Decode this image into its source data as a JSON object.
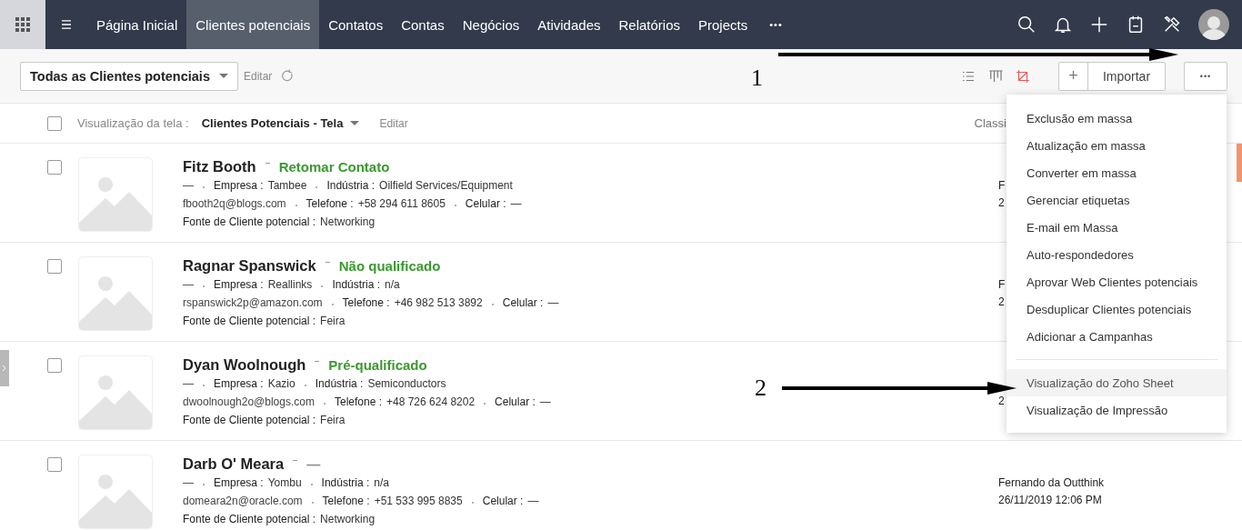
{
  "nav": {
    "tabs": [
      {
        "label": "Página Inicial",
        "selected": false
      },
      {
        "label": "Clientes potenciais",
        "selected": true
      },
      {
        "label": "Contatos",
        "selected": false
      },
      {
        "label": "Contas",
        "selected": false
      },
      {
        "label": "Negócios",
        "selected": false
      },
      {
        "label": "Atividades",
        "selected": false
      },
      {
        "label": "Relatórios",
        "selected": false
      },
      {
        "label": "Projects",
        "selected": false
      }
    ],
    "more": "•••"
  },
  "toolbar": {
    "view_select": "Todas as Clientes potenciais",
    "edit_link": "Editar",
    "add": "+",
    "import": "Importar",
    "more": "•••"
  },
  "subheader": {
    "checked": false,
    "view_label": "Visualização da tela :",
    "view_name": "Clientes Potenciais - Tela",
    "edit_link": "Editar",
    "sort_label": "Classi"
  },
  "rows": [
    {
      "checked": false,
      "name": "Fitz Booth",
      "status": {
        "text": "Retomar Contato",
        "color": "#3a9a2e"
      },
      "lines": [
        [
          {
            "value": "—"
          },
          {
            "label": "Empresa :",
            "value": "Tambee"
          },
          {
            "label": "Indústria :",
            "value": "Oilfield Services/Equipment"
          }
        ],
        [
          {
            "value": "fbooth2q@blogs.com"
          },
          {
            "label": "Telefone :",
            "value": "+58 294 611 8605"
          },
          {
            "label": "Celular :",
            "value": "—"
          }
        ],
        [
          {
            "label": "Fonte de Cliente potencial :",
            "value": "Networking"
          }
        ]
      ],
      "owner": "F",
      "date": "2"
    },
    {
      "checked": false,
      "name": "Ragnar Spanswick",
      "status": {
        "text": "Não qualificado",
        "color": "#3a9a2e"
      },
      "lines": [
        [
          {
            "value": "—"
          },
          {
            "label": "Empresa :",
            "value": "Reallinks"
          },
          {
            "label": "Indústria :",
            "value": "n/a"
          }
        ],
        [
          {
            "value": "rspanswick2p@amazon.com"
          },
          {
            "label": "Telefone :",
            "value": "+46 982 513 3892"
          },
          {
            "label": "Celular :",
            "value": "—"
          }
        ],
        [
          {
            "label": "Fonte de Cliente potencial :",
            "value": "Feira"
          }
        ]
      ],
      "owner": "F",
      "date": "2"
    },
    {
      "checked": false,
      "name": "Dyan Woolnough",
      "status": {
        "text": "Pré-qualificado",
        "color": "#3a9a2e"
      },
      "lines": [
        [
          {
            "value": "—"
          },
          {
            "label": "Empresa :",
            "value": "Kazio"
          },
          {
            "label": "Indústria :",
            "value": "Semiconductors"
          }
        ],
        [
          {
            "value": "dwoolnough2o@blogs.com"
          },
          {
            "label": "Telefone :",
            "value": "+48 726 624 8202"
          },
          {
            "label": "Celular :",
            "value": "—"
          }
        ],
        [
          {
            "label": "Fonte de Cliente potencial :",
            "value": "Feira"
          }
        ]
      ],
      "date": "2"
    },
    {
      "checked": false,
      "name": "Darb O' Meara",
      "status": {
        "text": "—",
        "color": "#888888"
      },
      "lines": [
        [
          {
            "value": "—"
          },
          {
            "label": "Empresa :",
            "value": "Yombu"
          },
          {
            "label": "Indústria :",
            "value": "n/a"
          }
        ],
        [
          {
            "value": "domeara2n@oracle.com"
          },
          {
            "label": "Telefone :",
            "value": "+51 533 995 8835"
          },
          {
            "label": "Celular :",
            "value": "—"
          }
        ],
        [
          {
            "label": "Fonte de Cliente potencial :",
            "value": "Networking"
          }
        ]
      ],
      "owner": "Fernando da Outthink",
      "date": "26/11/2019 12:06 PM"
    }
  ],
  "menu": {
    "groups": [
      [
        {
          "label": "Exclusão em massa",
          "selected": false
        },
        {
          "label": "Atualização em massa",
          "selected": false
        },
        {
          "label": "Converter em massa",
          "selected": false
        },
        {
          "label": "Gerenciar etiquetas",
          "selected": false
        },
        {
          "label": "E-mail em Massa",
          "selected": false
        },
        {
          "label": "Auto-respondedores",
          "selected": false
        },
        {
          "label": "Aprovar Web Clientes potenciais",
          "selected": false
        },
        {
          "label": "Desduplicar Clientes potenciais",
          "selected": false
        },
        {
          "label": "Adicionar a Campanhas",
          "selected": false
        }
      ],
      [
        {
          "label": "Visualização do Zoho Sheet",
          "selected": true
        },
        {
          "label": "Visualização de Impressão",
          "selected": false
        }
      ]
    ]
  },
  "annotations": [
    {
      "number": "1"
    },
    {
      "number": "2"
    }
  ]
}
